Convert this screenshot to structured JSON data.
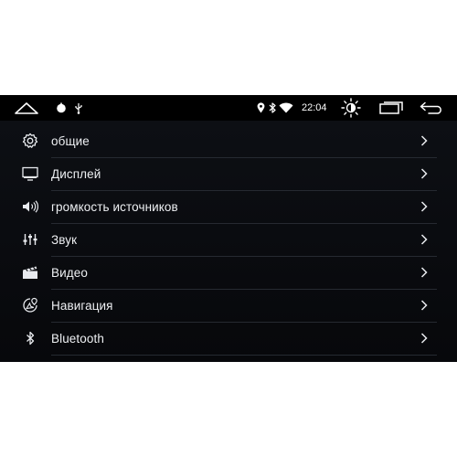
{
  "status_bar": {
    "time": "22:04",
    "icons": [
      "home-icon",
      "notification-icon",
      "usb-icon",
      "location-icon",
      "bluetooth-icon",
      "wifi-icon",
      "brightness-icon",
      "recent-apps-icon",
      "back-icon"
    ]
  },
  "menu": {
    "items": [
      {
        "label": "общие",
        "icon": "gear-icon"
      },
      {
        "label": "Дисплей",
        "icon": "display-icon"
      },
      {
        "label": "громкость источников",
        "icon": "volume-icon"
      },
      {
        "label": "Звук",
        "icon": "equalizer-icon"
      },
      {
        "label": "Видео",
        "icon": "clapperboard-icon"
      },
      {
        "label": "Навигация",
        "icon": "navigation-icon"
      },
      {
        "label": "Bluetooth",
        "icon": "bluetooth-icon"
      }
    ]
  },
  "colors": {
    "screen_bg": "#08090c",
    "text": "#eef0f3",
    "divider": "#262a31"
  }
}
